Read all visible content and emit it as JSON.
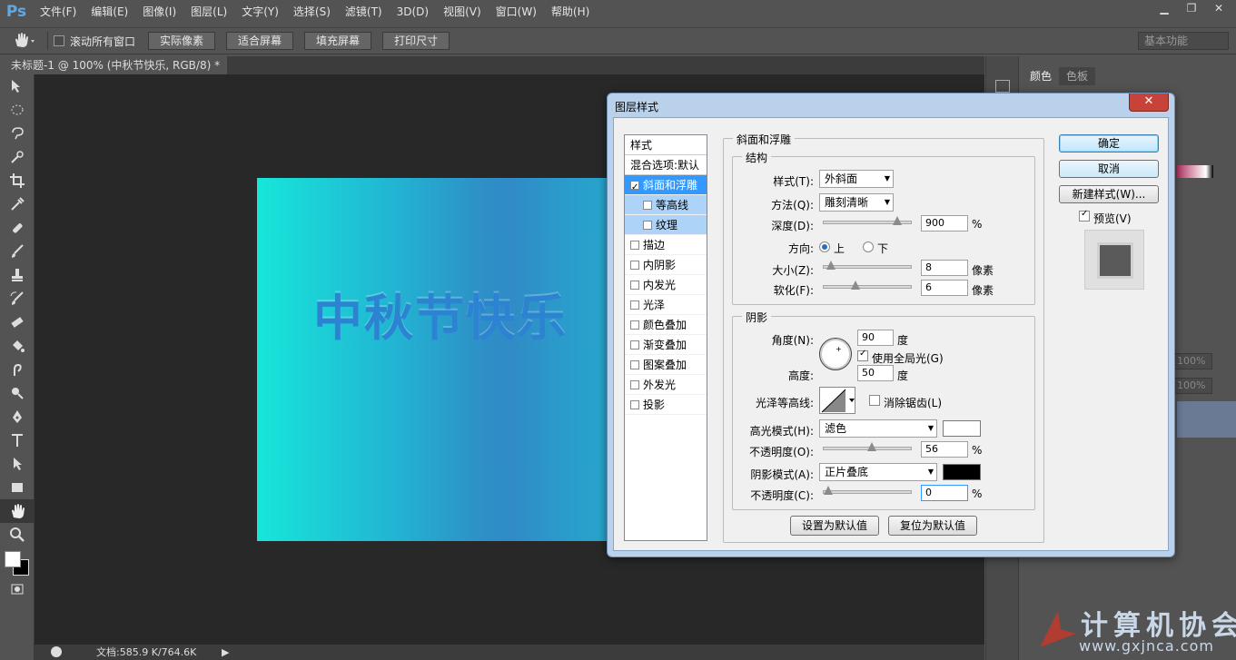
{
  "menubar": {
    "logo": "Ps",
    "items": [
      "文件(F)",
      "编辑(E)",
      "图像(I)",
      "图层(L)",
      "文字(Y)",
      "选择(S)",
      "滤镜(T)",
      "3D(D)",
      "视图(V)",
      "窗口(W)",
      "帮助(H)"
    ]
  },
  "options": {
    "scroll_all_label": "滚动所有窗口",
    "buttons": [
      "实际像素",
      "适合屏幕",
      "填充屏幕",
      "打印尺寸"
    ],
    "workspace": "基本功能"
  },
  "document": {
    "tab_title": "未标题-1 @ 100% (中秋节快乐, RGB/8) *",
    "artwork_text": "中秋节快乐",
    "status": "文档:585.9 K/764.6K"
  },
  "right_panel": {
    "tabs": [
      "颜色",
      "色板"
    ],
    "percents": [
      "100%",
      "100%"
    ]
  },
  "watermark": {
    "text": "计算机协会",
    "url": "www.gxjnca.com"
  },
  "dialog": {
    "title": "图层样式",
    "close": "✕",
    "style_list": [
      {
        "label": "样式",
        "type": "hdr"
      },
      {
        "label": "混合选项:默认",
        "type": "hdr"
      },
      {
        "label": "斜面和浮雕",
        "type": "sel",
        "checked": true
      },
      {
        "label": "等高线",
        "type": "sub",
        "checked": false
      },
      {
        "label": "纹理",
        "type": "sub",
        "checked": false
      },
      {
        "label": "描边",
        "type": "item",
        "checked": false
      },
      {
        "label": "内阴影",
        "type": "item",
        "checked": false
      },
      {
        "label": "内发光",
        "type": "item",
        "checked": false
      },
      {
        "label": "光泽",
        "type": "item",
        "checked": false
      },
      {
        "label": "颜色叠加",
        "type": "item",
        "checked": false
      },
      {
        "label": "渐变叠加",
        "type": "item",
        "checked": false
      },
      {
        "label": "图案叠加",
        "type": "item",
        "checked": false
      },
      {
        "label": "外发光",
        "type": "item",
        "checked": false
      },
      {
        "label": "投影",
        "type": "item",
        "checked": false
      }
    ],
    "section_title": "斜面和浮雕",
    "structure": {
      "title": "结构",
      "style_label": "样式(T):",
      "style_value": "外斜面",
      "technique_label": "方法(Q):",
      "technique_value": "雕刻清晰",
      "depth_label": "深度(D):",
      "depth_value": "900",
      "depth_unit": "%",
      "depth_pos": 0.88,
      "direction_label": "方向:",
      "dir_up": "上",
      "dir_down": "下",
      "size_label": "大小(Z):",
      "size_value": "8",
      "size_unit": "像素",
      "size_pos": 0.04,
      "soften_label": "软化(F):",
      "soften_value": "6",
      "soften_unit": "像素",
      "soften_pos": 0.35
    },
    "shading": {
      "title": "阴影",
      "angle_label": "角度(N):",
      "angle_value": "90",
      "angle_unit": "度",
      "global_light": "使用全局光(G)",
      "altitude_label": "高度:",
      "altitude_value": "50",
      "altitude_unit": "度",
      "gloss_label": "光泽等高线:",
      "antialias": "消除锯齿(L)",
      "highlight_label": "高光模式(H):",
      "highlight_mode": "滤色",
      "highlight_color": "#ffffff",
      "hl_opacity_label": "不透明度(O):",
      "hl_opacity_value": "56",
      "hl_opacity_unit": "%",
      "hl_opacity_pos": 0.56,
      "shadow_label": "阴影模式(A):",
      "shadow_mode": "正片叠底",
      "shadow_color": "#000000",
      "sh_opacity_label": "不透明度(C):",
      "sh_opacity_value": "0",
      "sh_opacity_unit": "%",
      "sh_opacity_pos": 0.0
    },
    "make_default": "设置为默认值",
    "reset_default": "复位为默认值",
    "ok": "确定",
    "cancel": "取消",
    "new_style": "新建样式(W)...",
    "preview_label": "预览(V)"
  }
}
